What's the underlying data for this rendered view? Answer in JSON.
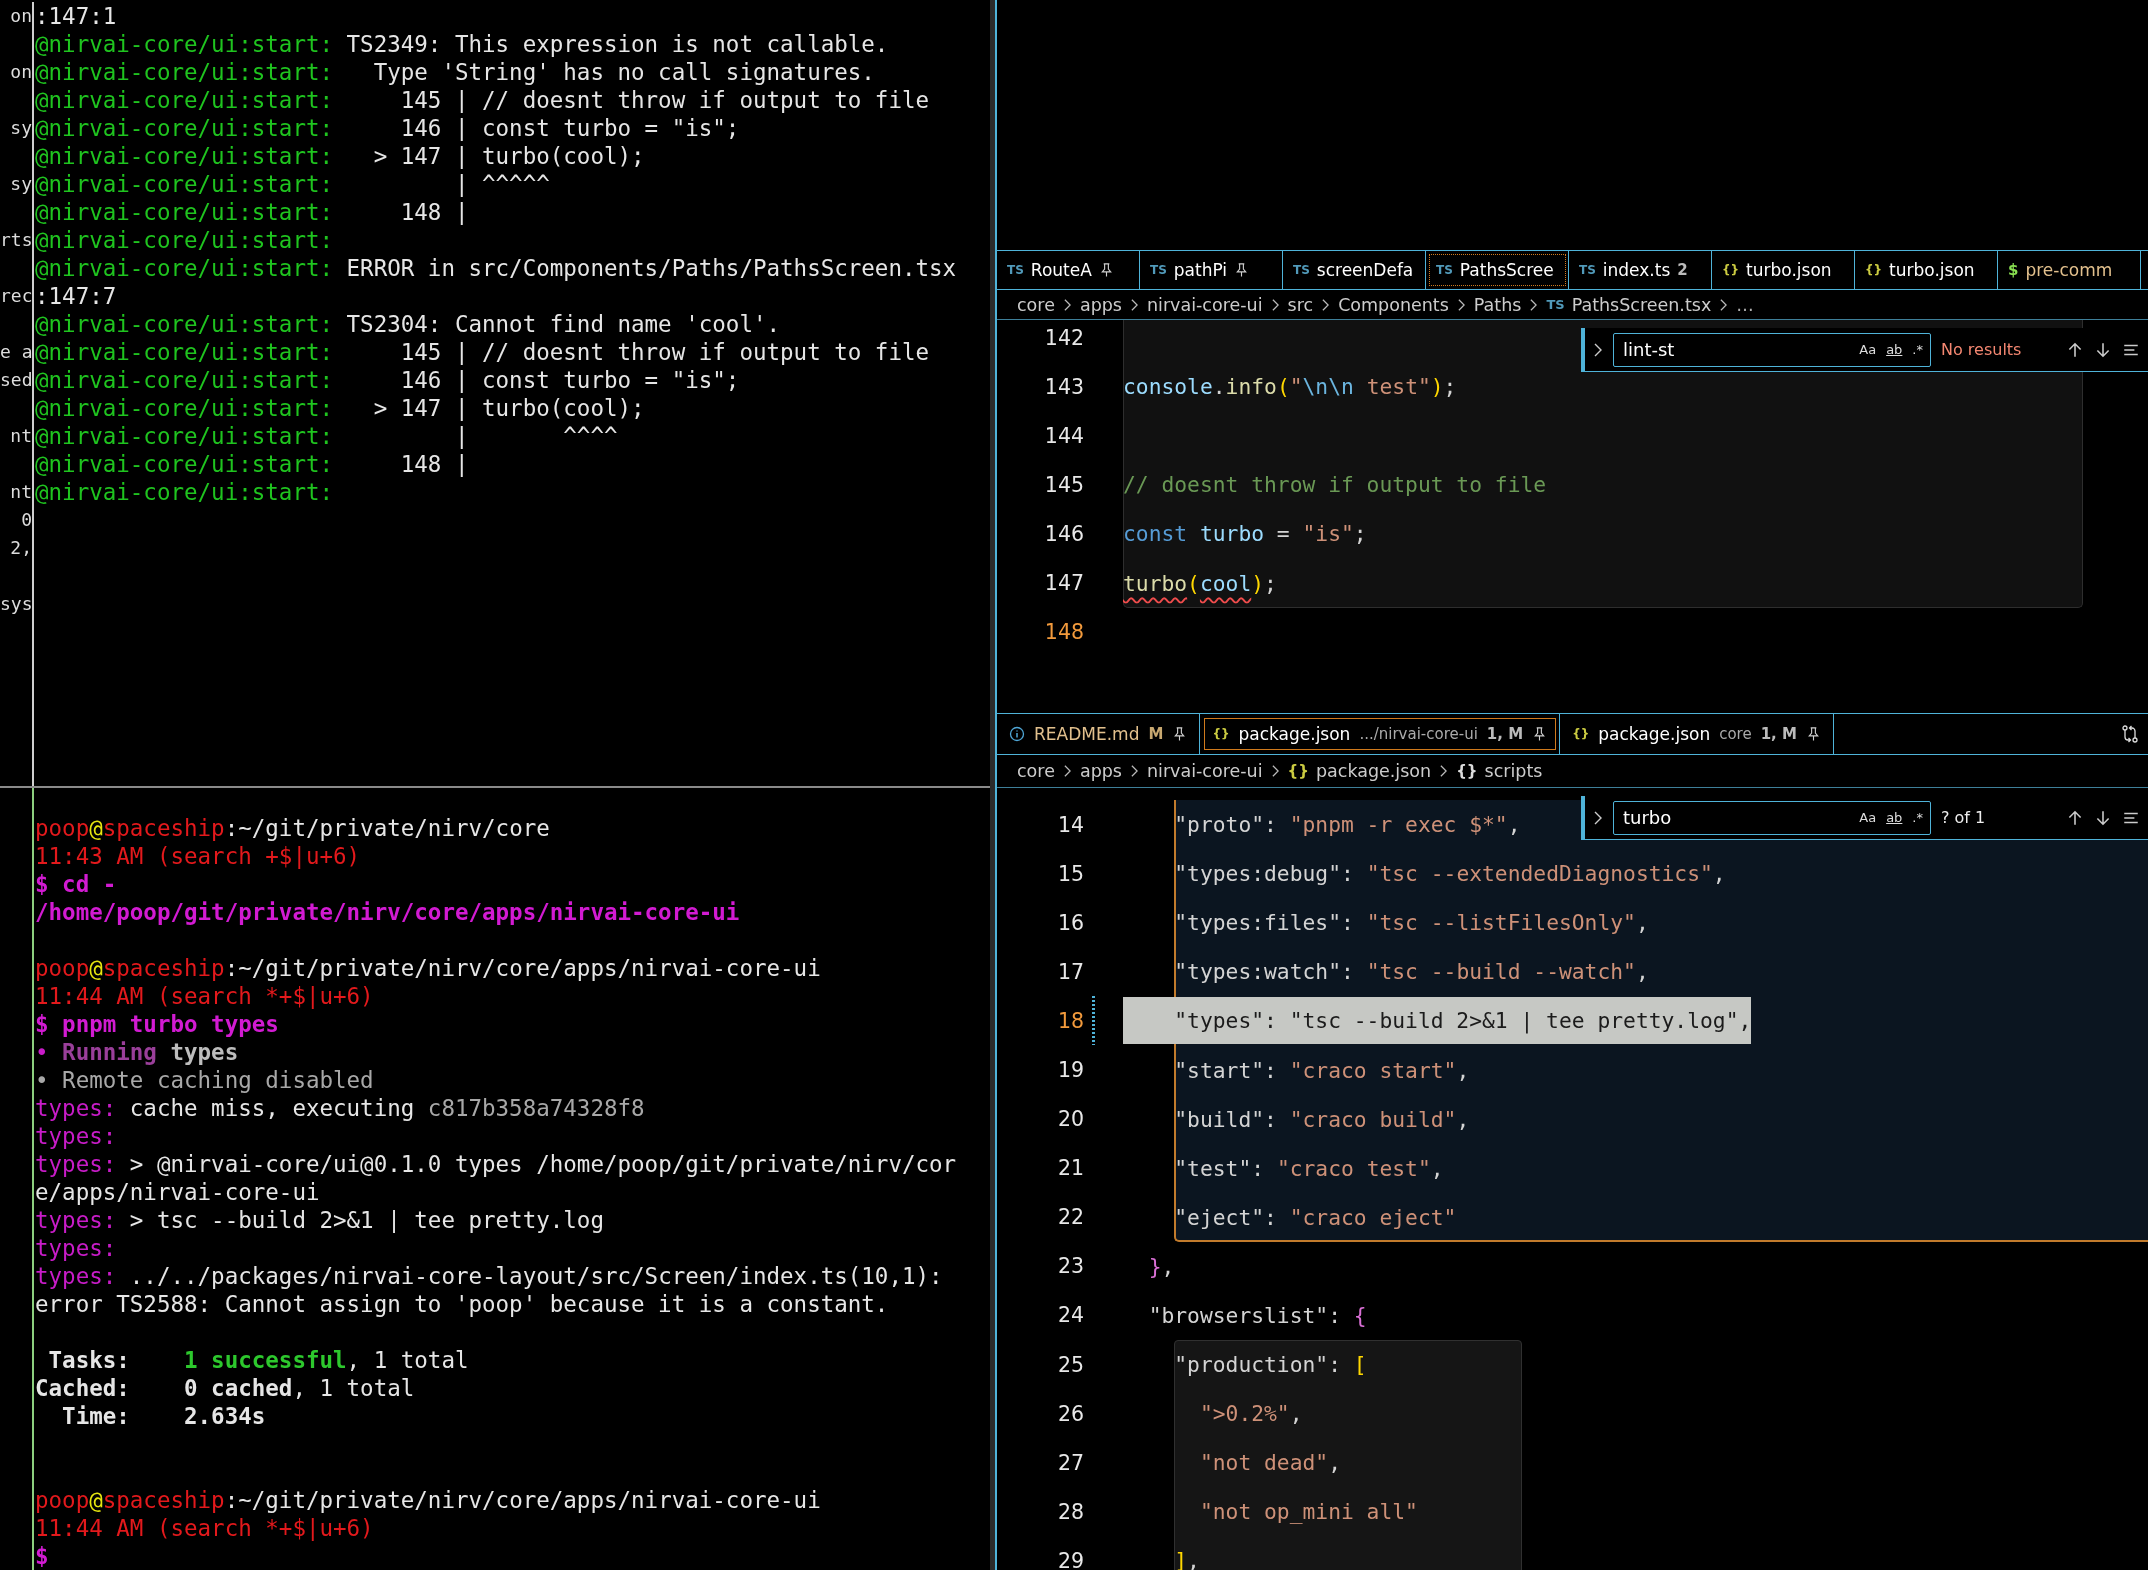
{
  "terminal_top": {
    "lines": [
      {
        "fragment": "on",
        "spans": [
          {
            "kind": "plain",
            "text": ":147:1"
          }
        ]
      },
      {
        "spans": [
          {
            "kind": "prefix",
            "text": "@nirvai-core/ui:start:"
          },
          {
            "kind": "plain",
            "text": " TS2349: This expression is not callable."
          }
        ]
      },
      {
        "fragment": "on",
        "spans": [
          {
            "kind": "prefix",
            "text": "@nirvai-core/ui:start:"
          },
          {
            "kind": "plain",
            "text": "   Type 'String' has no call signatures."
          }
        ]
      },
      {
        "spans": [
          {
            "kind": "prefix",
            "text": "@nirvai-core/ui:start:"
          },
          {
            "kind": "plain",
            "text": "     145 | // doesnt throw if output to file"
          }
        ]
      },
      {
        "fragment": "sy",
        "spans": [
          {
            "kind": "prefix",
            "text": "@nirvai-core/ui:start:"
          },
          {
            "kind": "plain",
            "text": "     146 | const turbo = \"is\";"
          }
        ]
      },
      {
        "spans": [
          {
            "kind": "prefix",
            "text": "@nirvai-core/ui:start:"
          },
          {
            "kind": "plain",
            "text": "   > 147 | turbo(cool);"
          }
        ]
      },
      {
        "fragment": "sy",
        "spans": [
          {
            "kind": "prefix",
            "text": "@nirvai-core/ui:start:"
          },
          {
            "kind": "plain",
            "text": "         | ^^^^^"
          }
        ]
      },
      {
        "spans": [
          {
            "kind": "prefix",
            "text": "@nirvai-core/ui:start:"
          },
          {
            "kind": "plain",
            "text": "     148 |"
          }
        ]
      },
      {
        "fragment": "rts",
        "spans": [
          {
            "kind": "prefix",
            "text": "@nirvai-core/ui:start:"
          }
        ]
      },
      {
        "spans": [
          {
            "kind": "prefix",
            "text": "@nirvai-core/ui:start:"
          },
          {
            "kind": "plain",
            "text": " ERROR in src/Components/Paths/PathsScreen.tsx"
          }
        ]
      },
      {
        "fragment": "rec",
        "spans": [
          {
            "kind": "plain",
            "text": ":147:7"
          }
        ]
      },
      {
        "spans": [
          {
            "kind": "prefix",
            "text": "@nirvai-core/ui:start:"
          },
          {
            "kind": "plain",
            "text": " TS2304: Cannot find name 'cool'."
          }
        ]
      },
      {
        "fragment": "e a",
        "spans": [
          {
            "kind": "prefix",
            "text": "@nirvai-core/ui:start:"
          },
          {
            "kind": "plain",
            "text": "     145 | // doesnt throw if output to file"
          }
        ]
      },
      {
        "fragment": "sed",
        "spans": [
          {
            "kind": "prefix",
            "text": "@nirvai-core/ui:start:"
          },
          {
            "kind": "plain",
            "text": "     146 | const turbo = \"is\";"
          }
        ]
      },
      {
        "spans": [
          {
            "kind": "prefix",
            "text": "@nirvai-core/ui:start:"
          },
          {
            "kind": "plain",
            "text": "   > 147 | turbo(cool);"
          }
        ]
      },
      {
        "fragment": "nt",
        "spans": [
          {
            "kind": "prefix",
            "text": "@nirvai-core/ui:start:"
          },
          {
            "kind": "plain",
            "text": "         |       ^^^^"
          }
        ]
      },
      {
        "spans": [
          {
            "kind": "prefix",
            "text": "@nirvai-core/ui:start:"
          },
          {
            "kind": "plain",
            "text": "     148 |"
          }
        ]
      },
      {
        "fragment": "nt",
        "spans": [
          {
            "kind": "prefix",
            "text": "@nirvai-core/ui:start:"
          }
        ]
      },
      {
        "fragment": "0"
      },
      {
        "fragment": "2,"
      },
      {
        "fragment": "sys",
        "gap_before": true
      }
    ]
  },
  "terminal_bottom": {
    "lines": [
      {
        "spans": [
          {
            "kind": "user",
            "text": "poop"
          },
          {
            "kind": "at",
            "text": "@"
          },
          {
            "kind": "host",
            "text": "spaceship"
          },
          {
            "kind": "plain",
            "text": ":~/git/private/nirv/core"
          }
        ]
      },
      {
        "spans": [
          {
            "kind": "time",
            "text": "11:43 AM (search +$|u+6)"
          }
        ]
      },
      {
        "spans": [
          {
            "kind": "cmd",
            "text": "$ cd -"
          }
        ]
      },
      {
        "spans": [
          {
            "kind": "cmd",
            "text": "/home/poop/git/private/nirv/core/apps/nirvai-core-ui"
          }
        ]
      },
      {
        "gap_before": true,
        "spans": [
          {
            "kind": "user",
            "text": "poop"
          },
          {
            "kind": "at",
            "text": "@"
          },
          {
            "kind": "host",
            "text": "spaceship"
          },
          {
            "kind": "plain",
            "text": ":~/git/private/nirv/core/apps/nirvai-core-ui"
          }
        ]
      },
      {
        "spans": [
          {
            "kind": "time",
            "text": "11:44 AM (search *+$|u+6)"
          }
        ]
      },
      {
        "spans": [
          {
            "kind": "cmd",
            "text": "$ pnpm turbo types"
          }
        ]
      },
      {
        "spans": [
          {
            "kind": "label",
            "text": "• "
          },
          {
            "kind": "running",
            "text": "Running"
          },
          {
            "kind": "boldgrey",
            "text": " types"
          }
        ]
      },
      {
        "spans": [
          {
            "kind": "dim",
            "text": "• Remote caching disabled"
          }
        ]
      },
      {
        "spans": [
          {
            "kind": "label",
            "text": "types:"
          },
          {
            "kind": "plain",
            "text": " cache miss, executing "
          },
          {
            "kind": "dim",
            "text": "c817b358a74328f8"
          }
        ]
      },
      {
        "spans": [
          {
            "kind": "label",
            "text": "types:"
          }
        ]
      },
      {
        "spans": [
          {
            "kind": "label",
            "text": "types:"
          },
          {
            "kind": "plain",
            "text": " > @nirvai-core/ui@0.1.0 types /home/poop/git/private/nirv/cor"
          }
        ]
      },
      {
        "spans": [
          {
            "kind": "plain",
            "text": "e/apps/nirvai-core-ui"
          }
        ]
      },
      {
        "spans": [
          {
            "kind": "label",
            "text": "types:"
          },
          {
            "kind": "plain",
            "text": " > tsc --build 2>&1 | tee pretty.log"
          }
        ]
      },
      {
        "spans": [
          {
            "kind": "label",
            "text": "types:"
          }
        ]
      },
      {
        "spans": [
          {
            "kind": "label",
            "text": "types:"
          },
          {
            "kind": "plain",
            "text": " ../../packages/nirvai-core-layout/src/Screen/index.ts(10,1):"
          }
        ]
      },
      {
        "spans": [
          {
            "kind": "plain",
            "text": "error TS2588: Cannot assign to 'poop' because it is a constant."
          }
        ]
      },
      {
        "gap_before": true,
        "spans": [
          {
            "kind": "bold",
            "text": " Tasks:"
          },
          {
            "kind": "success",
            "text": "    1 successful"
          },
          {
            "kind": "plain",
            "text": ", 1 total"
          }
        ]
      },
      {
        "spans": [
          {
            "kind": "bold",
            "text": "Cached:"
          },
          {
            "kind": "bold",
            "text": "    0 cached"
          },
          {
            "kind": "plain",
            "text": ", 1 total"
          }
        ]
      },
      {
        "gap_after": true,
        "spans": [
          {
            "kind": "bold",
            "text": "  Time:"
          },
          {
            "kind": "bold",
            "text": "    2.634s"
          }
        ]
      },
      {
        "gap_before": true,
        "spans": [
          {
            "kind": "user",
            "text": "poop"
          },
          {
            "kind": "at",
            "text": "@"
          },
          {
            "kind": "host",
            "text": "spaceship"
          },
          {
            "kind": "plain",
            "text": ":~/git/private/nirv/core/apps/nirvai-core-ui"
          }
        ]
      },
      {
        "spans": [
          {
            "kind": "time",
            "text": "11:44 AM (search *+$|u+6)"
          }
        ]
      },
      {
        "spans": [
          {
            "kind": "cmd",
            "text": "$"
          }
        ]
      }
    ]
  },
  "editor_top": {
    "tabs": [
      {
        "kind": "ts",
        "icon": "TS",
        "label": "RouteA",
        "pinned": true,
        "selected": false,
        "modified": false
      },
      {
        "kind": "ts",
        "icon": "TS",
        "label": "pathPi",
        "pinned": true,
        "selected": false,
        "modified": false
      },
      {
        "kind": "ts",
        "icon": "TS",
        "label": "screenDefa",
        "pinned": false,
        "selected": false,
        "modified": false
      },
      {
        "kind": "ts",
        "icon": "TS",
        "label": "PathsScree",
        "pinned": false,
        "selected": true,
        "modified": false
      },
      {
        "kind": "ts",
        "icon": "TS",
        "label": "index.ts",
        "badge": "2",
        "pinned": false,
        "selected": false,
        "modified": false
      },
      {
        "kind": "json",
        "icon": "{}",
        "label": "turbo.json",
        "pinned": false,
        "selected": false,
        "modified": false
      },
      {
        "kind": "json",
        "icon": "{}",
        "label": "turbo.json",
        "pinned": false,
        "selected": false,
        "modified": false
      },
      {
        "kind": "shell",
        "icon": "$",
        "label": "pre-comm",
        "pinned": false,
        "selected": false,
        "modified": true
      }
    ],
    "breadcrumb": [
      {
        "kind": "folder",
        "text": "core"
      },
      {
        "kind": "folder",
        "text": "apps"
      },
      {
        "kind": "folder",
        "text": "nirvai-core-ui"
      },
      {
        "kind": "folder",
        "text": "src"
      },
      {
        "kind": "folder",
        "text": "Components"
      },
      {
        "kind": "folder",
        "text": "Paths"
      },
      {
        "kind": "ts",
        "icon": "TS",
        "text": "PathsScreen.tsx"
      },
      {
        "kind": "more",
        "text": "…"
      }
    ],
    "find": {
      "query": "lint-st",
      "options": [
        "Aa",
        "ab",
        ".*"
      ],
      "status": "No results",
      "found": false
    },
    "lines": [
      {
        "number": "142",
        "kind": "box",
        "current": false
      },
      {
        "number": "143",
        "kind": "box",
        "current": false,
        "tokens": [
          {
            "kind": "variable",
            "text": "console",
            "error": false
          },
          {
            "kind": "plain",
            "text": ".",
            "error": false
          },
          {
            "kind": "function",
            "text": "info",
            "error": false
          },
          {
            "kind": "bracket",
            "text": "(",
            "error": false
          },
          {
            "kind": "string",
            "text": "\"",
            "error": false
          },
          {
            "kind": "escape",
            "text": "\\n\\n",
            "error": false
          },
          {
            "kind": "string",
            "text": " test\"",
            "error": false
          },
          {
            "kind": "bracket",
            "text": ")",
            "error": false
          },
          {
            "kind": "plain",
            "text": ";",
            "error": false
          }
        ]
      },
      {
        "number": "144",
        "kind": "box",
        "current": false
      },
      {
        "number": "145",
        "kind": "box",
        "current": false,
        "tokens": [
          {
            "kind": "comment",
            "text": "// doesnt throw if output to file",
            "error": false
          }
        ]
      },
      {
        "number": "146",
        "kind": "box",
        "current": false,
        "tokens": [
          {
            "kind": "keyword",
            "text": "const",
            "error": false
          },
          {
            "kind": "variable",
            "text": " turbo",
            "error": false
          },
          {
            "kind": "plain",
            "text": " = ",
            "error": false
          },
          {
            "kind": "string",
            "text": "\"is\"",
            "error": false
          },
          {
            "kind": "plain",
            "text": ";",
            "error": false
          }
        ]
      },
      {
        "number": "147",
        "kind": "box",
        "current": false,
        "tokens": [
          {
            "kind": "function",
            "text": "turbo",
            "error": true
          },
          {
            "kind": "bracket",
            "text": "(",
            "error": false
          },
          {
            "kind": "variable",
            "text": "cool",
            "error": true
          },
          {
            "kind": "bracket",
            "text": ")",
            "error": false
          },
          {
            "kind": "plain",
            "text": ";",
            "error": false
          }
        ]
      },
      {
        "number": "148",
        "kind": "plain",
        "current": true
      }
    ]
  },
  "editor_bottom": {
    "tabs": [
      {
        "kind": "info",
        "label": "README.md",
        "badge": "M",
        "pinned": true,
        "selected": false,
        "modified": true
      },
      {
        "kind": "json",
        "icon": "{}",
        "label": "package.json",
        "description": ".../nirvai-core-ui",
        "badge": "1, M",
        "pinned": true,
        "selected": true,
        "modified": false
      },
      {
        "kind": "json",
        "icon": "{}",
        "label": "package.json",
        "description": "core",
        "badge": "1, M",
        "pinned": true,
        "selected": false,
        "modified": false
      }
    ],
    "breadcrumb": [
      {
        "kind": "folder",
        "text": "core"
      },
      {
        "kind": "folder",
        "text": "apps"
      },
      {
        "kind": "folder",
        "text": "nirvai-core-ui"
      },
      {
        "kind": "json",
        "icon": "{}",
        "text": "package.json"
      },
      {
        "kind": "symbol",
        "icon": "{}",
        "text": "scripts"
      }
    ],
    "find": {
      "query": "turbo",
      "options": [
        "Aa",
        "ab",
        ".*"
      ],
      "status": "? of 1",
      "found": true
    },
    "lines": [
      {
        "number": "14",
        "kind": "scope",
        "current": false,
        "highlighted": false,
        "changed": false,
        "tokens": [
          {
            "kind": "plain",
            "text": "    \"proto\": "
          },
          {
            "kind": "string",
            "text": "\"pnpm -r exec $*\""
          },
          {
            "kind": "plain",
            "text": ","
          }
        ]
      },
      {
        "number": "15",
        "kind": "scope",
        "current": false,
        "highlighted": false,
        "changed": false,
        "tokens": [
          {
            "kind": "plain",
            "text": "    \"types:debug\": "
          },
          {
            "kind": "string",
            "text": "\"tsc --extendedDiagnostics\""
          },
          {
            "kind": "plain",
            "text": ","
          }
        ]
      },
      {
        "number": "16",
        "kind": "scope",
        "current": false,
        "highlighted": false,
        "changed": false,
        "tokens": [
          {
            "kind": "plain",
            "text": "    \"types:files\": "
          },
          {
            "kind": "string",
            "text": "\"tsc --listFilesOnly\""
          },
          {
            "kind": "plain",
            "text": ","
          }
        ]
      },
      {
        "number": "17",
        "kind": "scope",
        "current": false,
        "highlighted": false,
        "changed": false,
        "tokens": [
          {
            "kind": "plain",
            "text": "    \"types:watch\": "
          },
          {
            "kind": "string",
            "text": "\"tsc --build --watch\""
          },
          {
            "kind": "plain",
            "text": ","
          }
        ]
      },
      {
        "number": "18",
        "kind": "scope",
        "current": true,
        "highlighted": true,
        "changed": true,
        "tokens": [
          {
            "kind": "plain",
            "text": "    \"types\": "
          },
          {
            "kind": "string",
            "text": "\"tsc --build 2>&1 | tee pretty.log\""
          },
          {
            "kind": "plain",
            "text": ","
          }
        ]
      },
      {
        "number": "19",
        "kind": "scope",
        "current": false,
        "highlighted": false,
        "changed": false,
        "tokens": [
          {
            "kind": "plain",
            "text": "    \"start\": "
          },
          {
            "kind": "string",
            "text": "\"craco start\""
          },
          {
            "kind": "plain",
            "text": ","
          }
        ]
      },
      {
        "number": "20",
        "kind": "scope",
        "current": false,
        "highlighted": false,
        "changed": false,
        "tokens": [
          {
            "kind": "plain",
            "text": "    \"build\": "
          },
          {
            "kind": "string",
            "text": "\"craco build\""
          },
          {
            "kind": "plain",
            "text": ","
          }
        ]
      },
      {
        "number": "21",
        "kind": "scope",
        "current": false,
        "highlighted": false,
        "changed": false,
        "tokens": [
          {
            "kind": "plain",
            "text": "    \"test\": "
          },
          {
            "kind": "string",
            "text": "\"craco test\""
          },
          {
            "kind": "plain",
            "text": ","
          }
        ]
      },
      {
        "number": "22",
        "kind": "scope",
        "current": false,
        "highlighted": false,
        "changed": false,
        "tokens": [
          {
            "kind": "plain",
            "text": "    \"eject\": "
          },
          {
            "kind": "string",
            "text": "\"craco eject\""
          }
        ]
      },
      {
        "number": "23",
        "kind": "plain",
        "current": false,
        "highlighted": false,
        "changed": false,
        "tokens": [
          {
            "kind": "brace",
            "text": "  }"
          },
          {
            "kind": "plain",
            "text": ","
          }
        ]
      },
      {
        "number": "24",
        "kind": "plain",
        "current": false,
        "highlighted": false,
        "changed": false,
        "tokens": [
          {
            "kind": "plain",
            "text": "  \"browserslist\": "
          },
          {
            "kind": "brace",
            "text": "{"
          }
        ]
      },
      {
        "number": "25",
        "kind": "box",
        "current": false,
        "highlighted": false,
        "changed": false,
        "tokens": [
          {
            "kind": "plain",
            "text": "    \"production\": "
          },
          {
            "kind": "bracket",
            "text": "["
          }
        ]
      },
      {
        "number": "26",
        "kind": "box",
        "current": false,
        "highlighted": false,
        "changed": false,
        "tokens": [
          {
            "kind": "string",
            "text": "      \">0.2%\""
          },
          {
            "kind": "plain",
            "text": ","
          }
        ]
      },
      {
        "number": "27",
        "kind": "box",
        "current": false,
        "highlighted": false,
        "changed": false,
        "tokens": [
          {
            "kind": "string",
            "text": "      \"not dead\""
          },
          {
            "kind": "plain",
            "text": ","
          }
        ]
      },
      {
        "number": "28",
        "kind": "box",
        "current": false,
        "highlighted": false,
        "changed": false,
        "tokens": [
          {
            "kind": "string",
            "text": "      \"not op_mini all\""
          }
        ]
      },
      {
        "number": "29",
        "kind": "box",
        "current": false,
        "highlighted": false,
        "changed": false,
        "tokens": [
          {
            "kind": "bracket",
            "text": "    ]"
          },
          {
            "kind": "plain",
            "text": ","
          }
        ]
      }
    ]
  }
}
